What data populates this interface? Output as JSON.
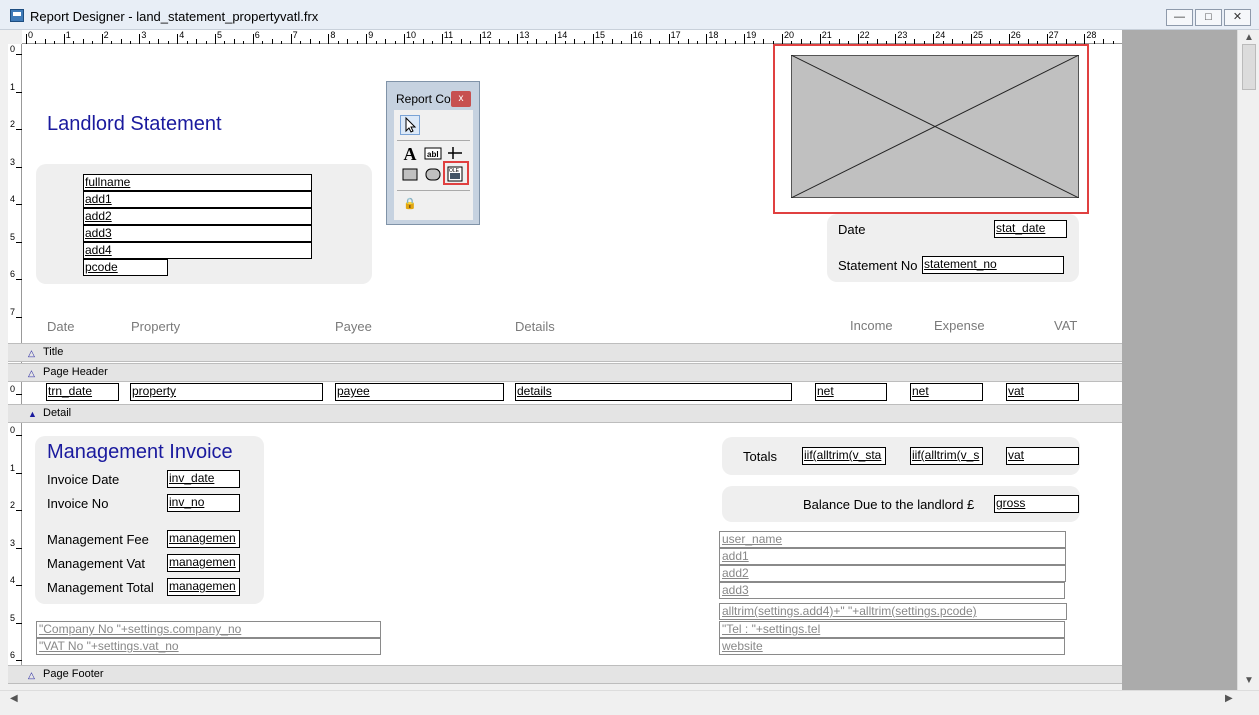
{
  "window": {
    "title": "Report Designer - land_statement_propertyvatl.frx"
  },
  "ruler": {
    "marks": [
      "0",
      "1",
      "2",
      "3",
      "4",
      "5",
      "6",
      "7",
      "8",
      "9",
      "10",
      "11",
      "12",
      "13",
      "14",
      "15",
      "16",
      "17",
      "18",
      "19",
      "20",
      "21",
      "22",
      "23",
      "24",
      "25",
      "26",
      "27",
      "28"
    ]
  },
  "vruler": {
    "title_marks": [
      "0",
      "1",
      "2",
      "3",
      "4",
      "5",
      "6",
      "7"
    ],
    "detail_marks": [
      "0"
    ],
    "footer_marks": [
      "0",
      "1",
      "2",
      "3",
      "4",
      "5",
      "6"
    ]
  },
  "title_band": {
    "heading": "Landlord Statement",
    "address_fields": [
      "fullname",
      "add1",
      "add2",
      "add3",
      "add4",
      "pcode"
    ],
    "date_label": "Date",
    "date_field": "stat_date",
    "statement_label": "Statement No",
    "statement_field": "statement_no",
    "columns": [
      "Date",
      "Property",
      "Payee",
      "Details",
      "Income",
      "Expense",
      "VAT"
    ]
  },
  "bands": {
    "title": "Title",
    "page_header": "Page Header",
    "detail": "Detail",
    "page_footer": "Page Footer"
  },
  "detail_fields": [
    "trn_date",
    "property",
    "payee",
    "details",
    "net",
    "net",
    "vat"
  ],
  "summary": {
    "heading": "Management Invoice",
    "invoice_date_label": "Invoice Date",
    "invoice_date_field": "inv_date",
    "invoice_no_label": "Invoice No",
    "invoice_no_field": "inv_no",
    "mgmt_fee_label": "Management Fee",
    "mgmt_fee_field": "managemen",
    "mgmt_vat_label": "Management Vat",
    "mgmt_vat_field": "managemen",
    "mgmt_total_label": "Management Total",
    "mgmt_total_field": "managemen",
    "totals_label": "Totals",
    "totals_fields": [
      "iif(alltrim(v_sta",
      "iif(alltrim(v_s",
      "vat"
    ],
    "balance_label": "Balance Due to the landlord £",
    "balance_field": "gross",
    "company_fields": [
      "\"Company No \"+settings.company_no",
      "\"VAT No \"+settings.vat_no"
    ],
    "user_fields": [
      "user_name",
      "add1",
      "add2",
      "add3",
      "alltrim(settings.add4)+\" \"+alltrim(settings.pcode)",
      "\"Tel : \"+settings.tel",
      "website"
    ]
  },
  "toolbox": {
    "title": "Report Co",
    "close": "x"
  }
}
